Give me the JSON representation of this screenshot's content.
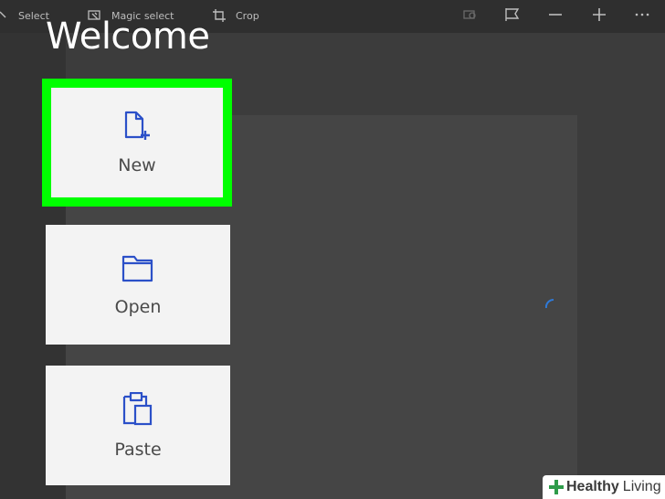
{
  "toolbar": {
    "select_label": "Select",
    "magic_select_label": "Magic select",
    "crop_label": "Crop"
  },
  "welcome": {
    "title": "Welcome"
  },
  "cards": {
    "new_label": "New",
    "open_label": "Open",
    "paste_label": "Paste"
  },
  "watermark": {
    "brand_bold": "Healthy",
    "brand_light": "Living"
  },
  "colors": {
    "highlight": "#00ff00",
    "icon_blue": "#2b50c8",
    "card_bg": "#f3f3f3",
    "app_bg": "#3c3c3c"
  }
}
